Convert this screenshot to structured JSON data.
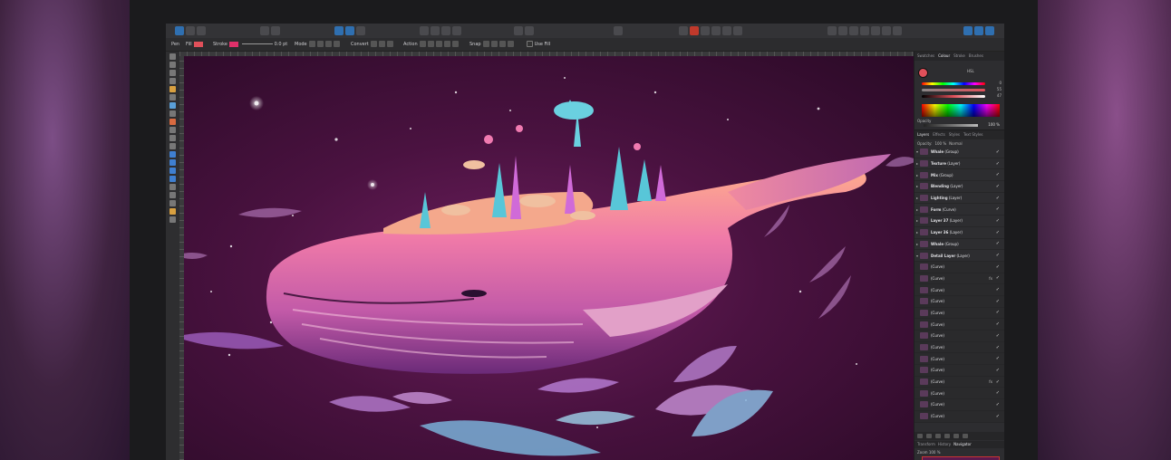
{
  "toolbar": {
    "ctx": {
      "pen": "Pen",
      "fill": "Fill",
      "stroke": "Stroke",
      "width": "0.0 pt",
      "mode": "Mode",
      "convert": "Convert",
      "action": "Action",
      "snap": "Snap",
      "use_fill": "Use Fill"
    },
    "fill_color": "#e0505a",
    "stroke_color": "#e0306a"
  },
  "color_panel": {
    "tabs": [
      "Swatches",
      "Colour",
      "Stroke",
      "Brushes"
    ],
    "active_tab": "Colour",
    "model": "HSL",
    "current_color": "#e0505a",
    "values": [
      "0",
      "55",
      "47"
    ],
    "opacity_label": "Opacity",
    "opacity_value": "100 %"
  },
  "layers_panel": {
    "tabs": [
      "Layers",
      "Effects",
      "Styles",
      "Text Styles"
    ],
    "active_tab": "Layers",
    "blend_label": "Opacity:",
    "blend_value": "100 %",
    "blend_mode": "Normal",
    "layers": [
      {
        "name": "Whale",
        "type": "(Group)",
        "expanded": true
      },
      {
        "name": "Texture",
        "type": "(Layer)"
      },
      {
        "name": "Mix",
        "type": "(Group)"
      },
      {
        "name": "Blending",
        "type": "(Layer)"
      },
      {
        "name": "Lighting",
        "type": "(Layer)"
      },
      {
        "name": "Form",
        "type": "(Curve)"
      },
      {
        "name": "Layer 37",
        "type": "(Layer)"
      },
      {
        "name": "Layer 36",
        "type": "(Layer)"
      },
      {
        "name": "Whale",
        "type": "(Group)"
      },
      {
        "name": "Detail Layer",
        "type": "(Layer)",
        "expanded": true
      }
    ],
    "curves": [
      "(Curve)",
      "(Curve)",
      "(Curve)",
      "(Curve)",
      "(Curve)",
      "(Curve)",
      "(Curve)",
      "(Curve)",
      "(Curve)",
      "(Curve)",
      "(Curve)",
      "(Curve)",
      "(Curve)",
      "(Curve)"
    ]
  },
  "navigator": {
    "tabs": [
      "Transform",
      "History",
      "Navigator"
    ],
    "active_tab": "Navigator",
    "zoom_label": "Zoom",
    "zoom_value": "100 %"
  }
}
